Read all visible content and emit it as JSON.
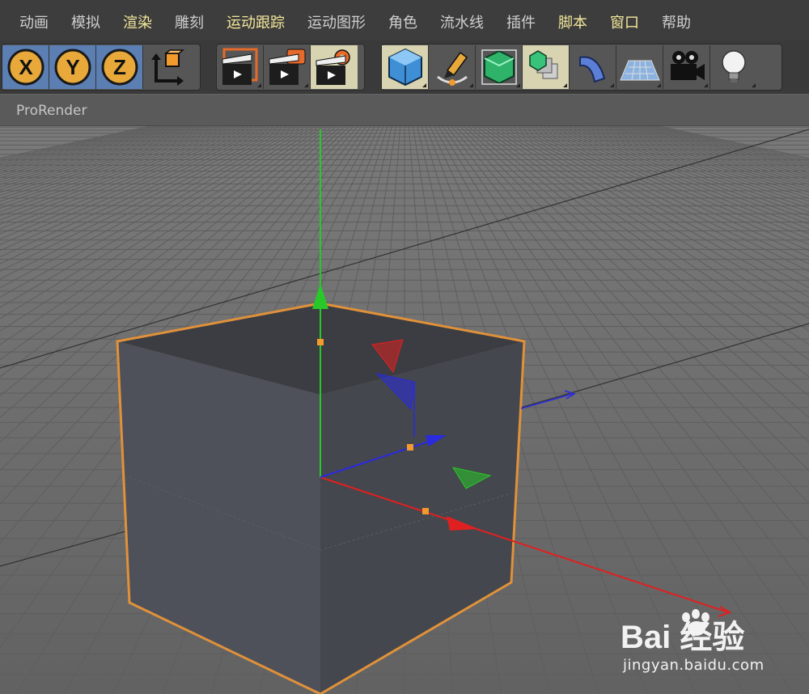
{
  "menu": [
    {
      "label": "动画",
      "highlight": false
    },
    {
      "label": "模拟",
      "highlight": false
    },
    {
      "label": "渲染",
      "highlight": true
    },
    {
      "label": "雕刻",
      "highlight": false
    },
    {
      "label": "运动跟踪",
      "highlight": true
    },
    {
      "label": "运动图形",
      "highlight": false
    },
    {
      "label": "角色",
      "highlight": false
    },
    {
      "label": "流水线",
      "highlight": false
    },
    {
      "label": "插件",
      "highlight": false
    },
    {
      "label": "脚本",
      "highlight": true
    },
    {
      "label": "窗口",
      "highlight": true
    },
    {
      "label": "帮助",
      "highlight": false
    }
  ],
  "toolbar": {
    "axis": [
      "X",
      "Y",
      "Z"
    ],
    "icons": {
      "coord": "coordinate-system-icon",
      "render_region": "render-region-icon",
      "render_view": "render-to-picture-viewer-icon",
      "render_settings": "render-settings-icon",
      "cube": "cube-icon",
      "pen": "pen-spline-icon",
      "subdiv": "subdivision-surface-icon",
      "array": "array-generator-icon",
      "deformer": "bend-deformer-icon",
      "floor": "floor-icon",
      "camera": "camera-icon",
      "light": "light-icon"
    }
  },
  "viewport": {
    "title": "ProRender",
    "background": "#6a6a6a",
    "selection_color": "#e0913a",
    "axis_colors": {
      "x": "#e02020",
      "y": "#28c828",
      "z": "#2a2ae0"
    }
  },
  "watermark": {
    "logo_text": "Bai  经验",
    "site": "jingyan.baidu.com"
  }
}
